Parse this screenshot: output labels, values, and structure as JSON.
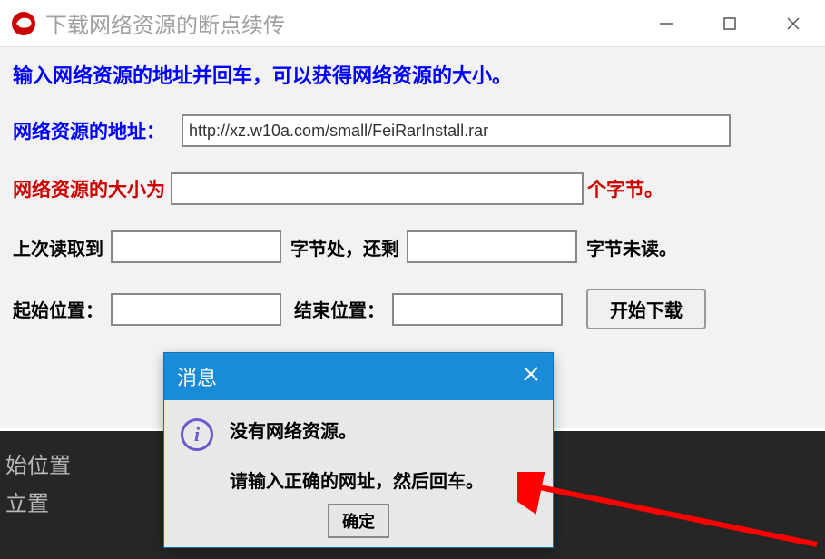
{
  "window": {
    "title": "下载网络资源的断点续传"
  },
  "main": {
    "instruction": "输入网络资源的地址并回车，可以获得网络资源的大小。",
    "url_label": "网络资源的地址：",
    "url_value": "http://xz.w10a.com/small/FeiRarInstall.rar",
    "size_label": "网络资源的大小为",
    "size_value": "",
    "size_suffix": "个字节。",
    "last_read_label": "上次读取到",
    "last_read_value": "",
    "remain_label": "字节处，还剩",
    "remain_value": "",
    "remain_suffix": "字节未读。",
    "start_pos_label": "起始位置：",
    "start_pos_value": "",
    "end_pos_label": "结束位置：",
    "end_pos_value": "",
    "start_button": "开始下载"
  },
  "dark_panel": {
    "line1": "始位置",
    "line2": "立置"
  },
  "dialog": {
    "title": "消息",
    "line1": "没有网络资源。",
    "line2": "请输入正确的网址，然后回车。",
    "ok": "确定"
  }
}
